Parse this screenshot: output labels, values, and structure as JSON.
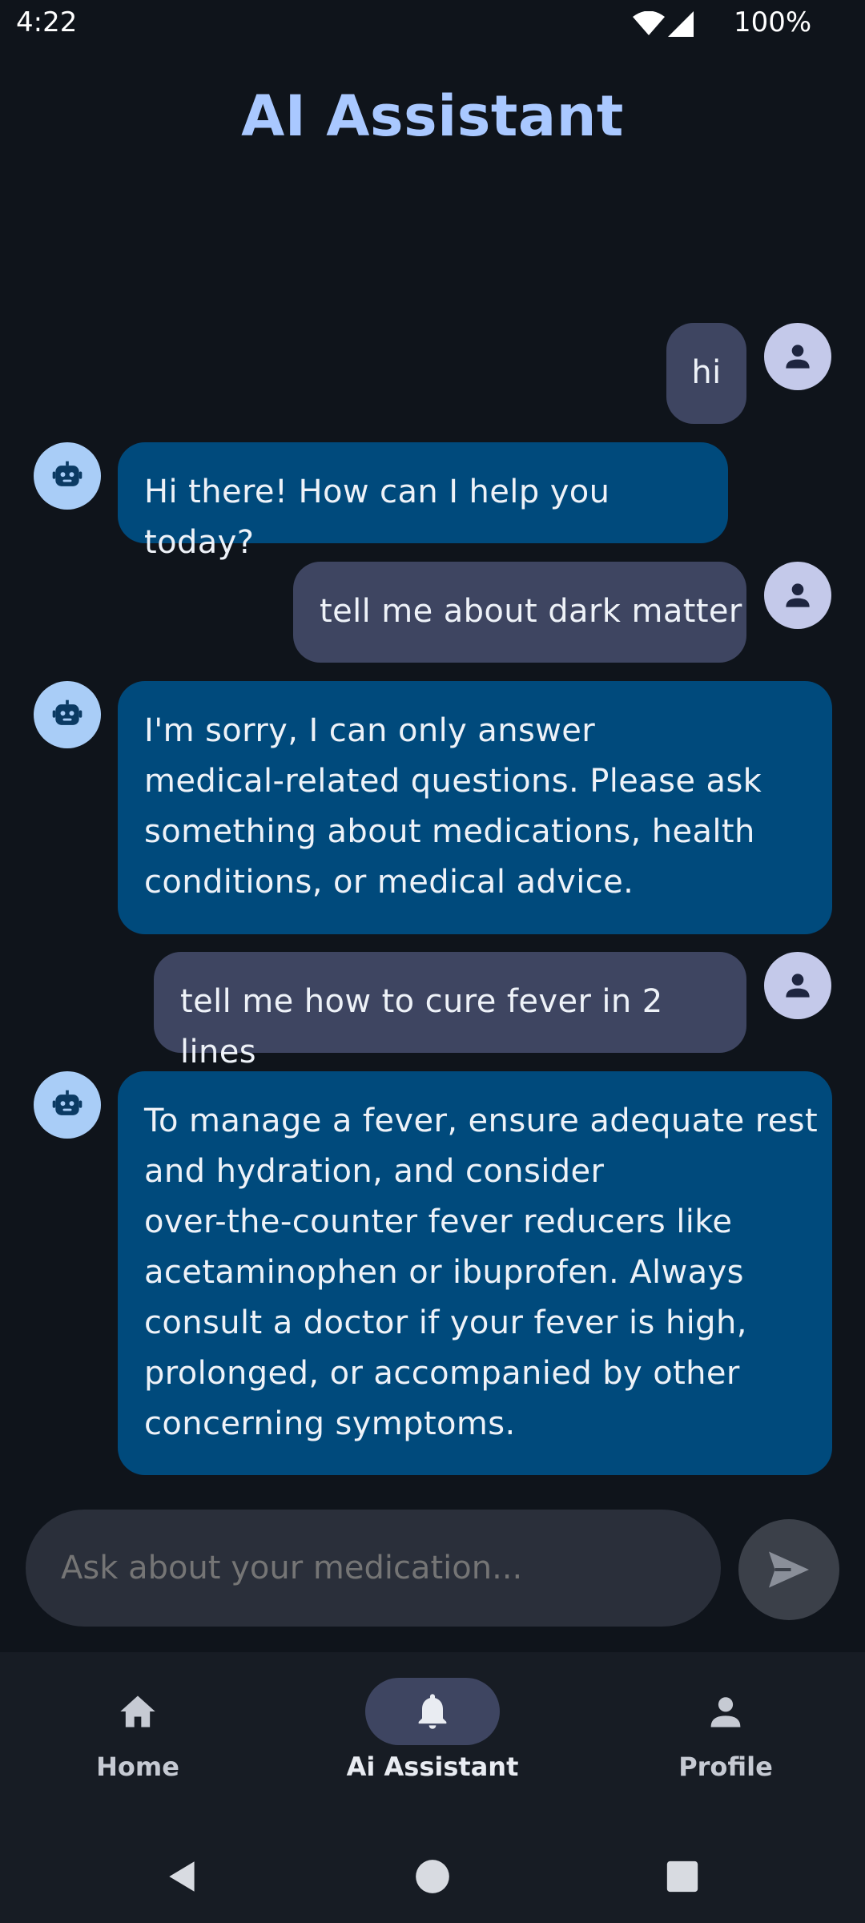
{
  "status_bar": {
    "time": "4:22",
    "battery": "100%",
    "icons": [
      "wifi-icon",
      "signal-icon"
    ]
  },
  "header": {
    "title": "AI Assistant"
  },
  "messages": [
    {
      "role": "user",
      "text": "hi"
    },
    {
      "role": "bot",
      "text": "Hi there! How can I help you today?"
    },
    {
      "role": "user",
      "text": "tell me about dark matter"
    },
    {
      "role": "bot",
      "text": "I'm sorry, I can only answer\nmedical-related questions. Please ask\nsomething about medications, health\nconditions, or medical advice."
    },
    {
      "role": "user",
      "text": "tell me how to cure fever in 2 lines"
    },
    {
      "role": "bot",
      "text": "To manage a fever, ensure adequate rest\nand hydration, and consider\nover-the-counter fever reducers like\nacetaminophen or ibuprofen. Always\nconsult a doctor if your fever is high,\nprolonged, or accompanied by other\nconcerning symptoms."
    }
  ],
  "input": {
    "placeholder": "Ask about your medication..."
  },
  "bottom_nav": {
    "items": [
      {
        "label": "Home",
        "icon": "home-icon",
        "active": false
      },
      {
        "label": "Ai Assistant",
        "icon": "bell-icon",
        "active": true
      },
      {
        "label": "Profile",
        "icon": "person-icon",
        "active": false
      }
    ]
  },
  "colors": {
    "background": "#0f141b",
    "title": "#a9c8ff",
    "user_bubble": "#3e4561",
    "bot_bubble": "#004a7c",
    "user_avatar": "#c4c9ea",
    "bot_avatar": "#a9cdf7"
  }
}
